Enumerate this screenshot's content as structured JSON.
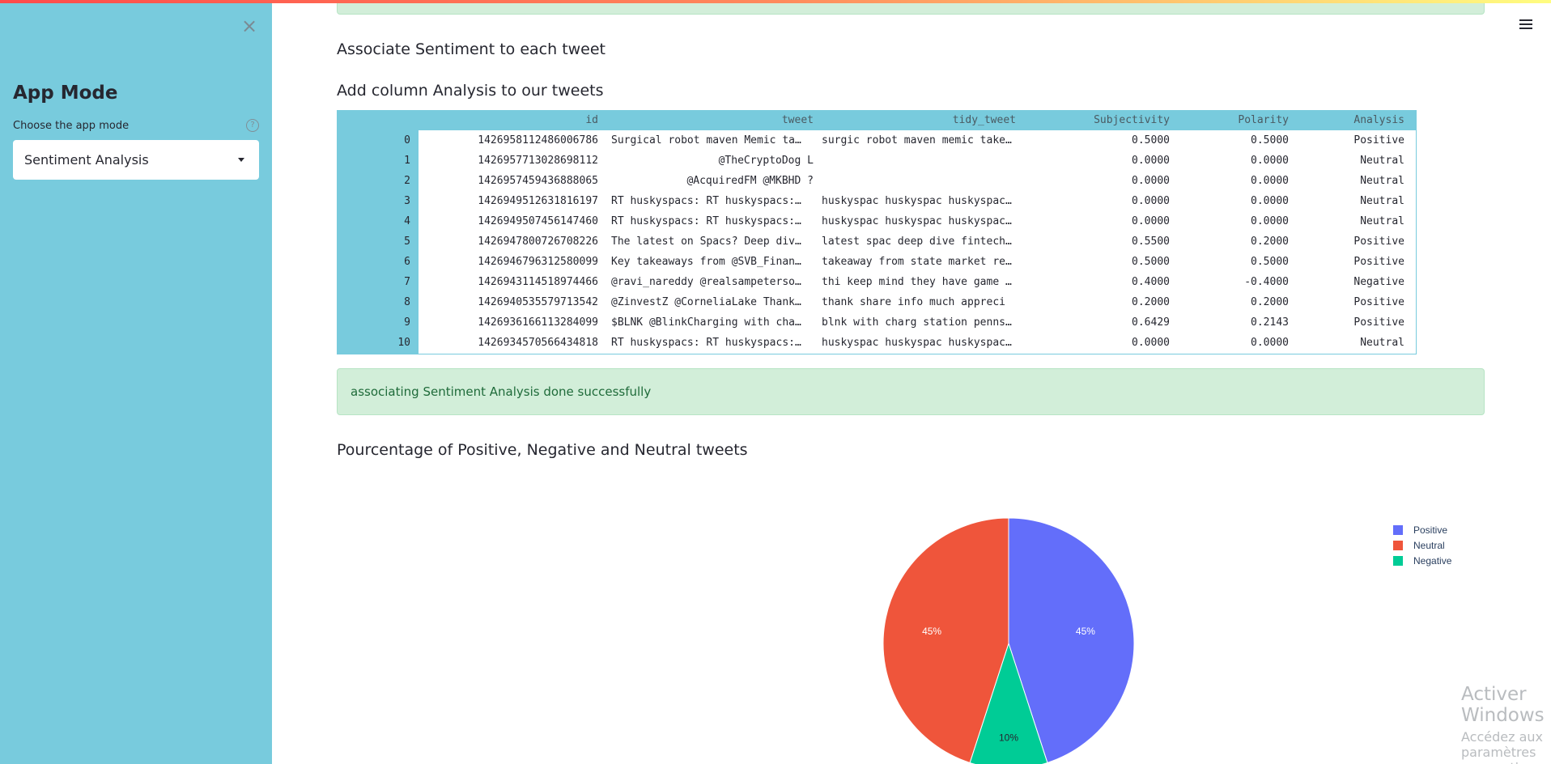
{
  "sidebar": {
    "close_icon": "close-icon",
    "title": "App Mode",
    "select_label": "Choose the app mode",
    "help_icon": "help-circle-icon",
    "help_glyph": "?",
    "selected_mode": "Sentiment Analysis"
  },
  "main": {
    "menu_icon": "hamburger-menu-icon",
    "heading_sentiment": "Associate Sentiment to each tweet",
    "heading_column": "Add column Analysis to our tweets",
    "success_message": "associating Sentiment Analysis done successfully",
    "heading_chart": "Pourcentage of Positive, Negative and Neutral tweets"
  },
  "table": {
    "columns": [
      "id",
      "tweet",
      "tidy_tweet",
      "Subjectivity",
      "Polarity",
      "Analysis"
    ],
    "rows": [
      {
        "index": "0",
        "id": "1426958112486006786",
        "tweet": "Surgical robot maven Memic ta…",
        "tidy_tweet": "surgic robot maven memic take…",
        "subjectivity": "0.5000",
        "polarity": "0.5000",
        "analysis": "Positive"
      },
      {
        "index": "1",
        "id": "1426957713028698112",
        "tweet": "@TheCryptoDog L",
        "tidy_tweet": "",
        "subjectivity": "0.0000",
        "polarity": "0.0000",
        "analysis": "Neutral"
      },
      {
        "index": "2",
        "id": "1426957459436888065",
        "tweet": "@AcquiredFM @MKBHD ?",
        "tidy_tweet": "",
        "subjectivity": "0.0000",
        "polarity": "0.0000",
        "analysis": "Neutral"
      },
      {
        "index": "3",
        "id": "1426949512631816197",
        "tweet": "RT huskyspacs: RT huskyspacs:…",
        "tidy_tweet": "huskyspac huskyspac huskyspac…",
        "subjectivity": "0.0000",
        "polarity": "0.0000",
        "analysis": "Neutral"
      },
      {
        "index": "4",
        "id": "1426949507456147460",
        "tweet": "RT huskyspacs: RT huskyspacs:…",
        "tidy_tweet": "huskyspac huskyspac huskyspac…",
        "subjectivity": "0.0000",
        "polarity": "0.0000",
        "analysis": "Neutral"
      },
      {
        "index": "5",
        "id": "1426947800726708226",
        "tweet": "The latest on Spacs? Deep div…",
        "tidy_tweet": "latest spac deep dive fintech…",
        "subjectivity": "0.5500",
        "polarity": "0.2000",
        "analysis": "Positive"
      },
      {
        "index": "6",
        "id": "1426946796312580099",
        "tweet": "Key takeaways from @SVB_Finan…",
        "tidy_tweet": "takeaway from state market re…",
        "subjectivity": "0.5000",
        "polarity": "0.5000",
        "analysis": "Positive"
      },
      {
        "index": "7",
        "id": "1426943114518974466",
        "tweet": "@ravi_nareddy @realsampeterso…",
        "tidy_tweet": "thi keep mind they have game …",
        "subjectivity": "0.4000",
        "polarity": "-0.4000",
        "analysis": "Negative"
      },
      {
        "index": "8",
        "id": "1426940535579713542",
        "tweet": "@ZinvestZ @CorneliaLake Thank…",
        "tidy_tweet": "thank share info much appreci",
        "subjectivity": "0.2000",
        "polarity": "0.2000",
        "analysis": "Positive"
      },
      {
        "index": "9",
        "id": "1426936166113284099",
        "tweet": "$BLNK @BlinkCharging with cha…",
        "tidy_tweet": "blnk with charg station penns…",
        "subjectivity": "0.6429",
        "polarity": "0.2143",
        "analysis": "Positive"
      },
      {
        "index": "10",
        "id": "1426934570566434818",
        "tweet": "RT huskyspacs: RT huskyspacs:…",
        "tidy_tweet": "huskyspac huskyspac huskyspac…",
        "subjectivity": "0.0000",
        "polarity": "0.0000",
        "analysis": "Neutral"
      }
    ]
  },
  "chart_data": {
    "type": "pie",
    "categories": [
      "Positive",
      "Neutral",
      "Negative"
    ],
    "values": [
      45,
      45,
      10
    ],
    "labels": [
      "45%",
      "45%",
      "10%"
    ],
    "colors": [
      "#636efa",
      "#ef553b",
      "#00cc96"
    ],
    "legend": "right"
  },
  "watermark": {
    "line1": "Activer Windows",
    "line2": "Accédez aux paramètres pour activer Windows."
  }
}
